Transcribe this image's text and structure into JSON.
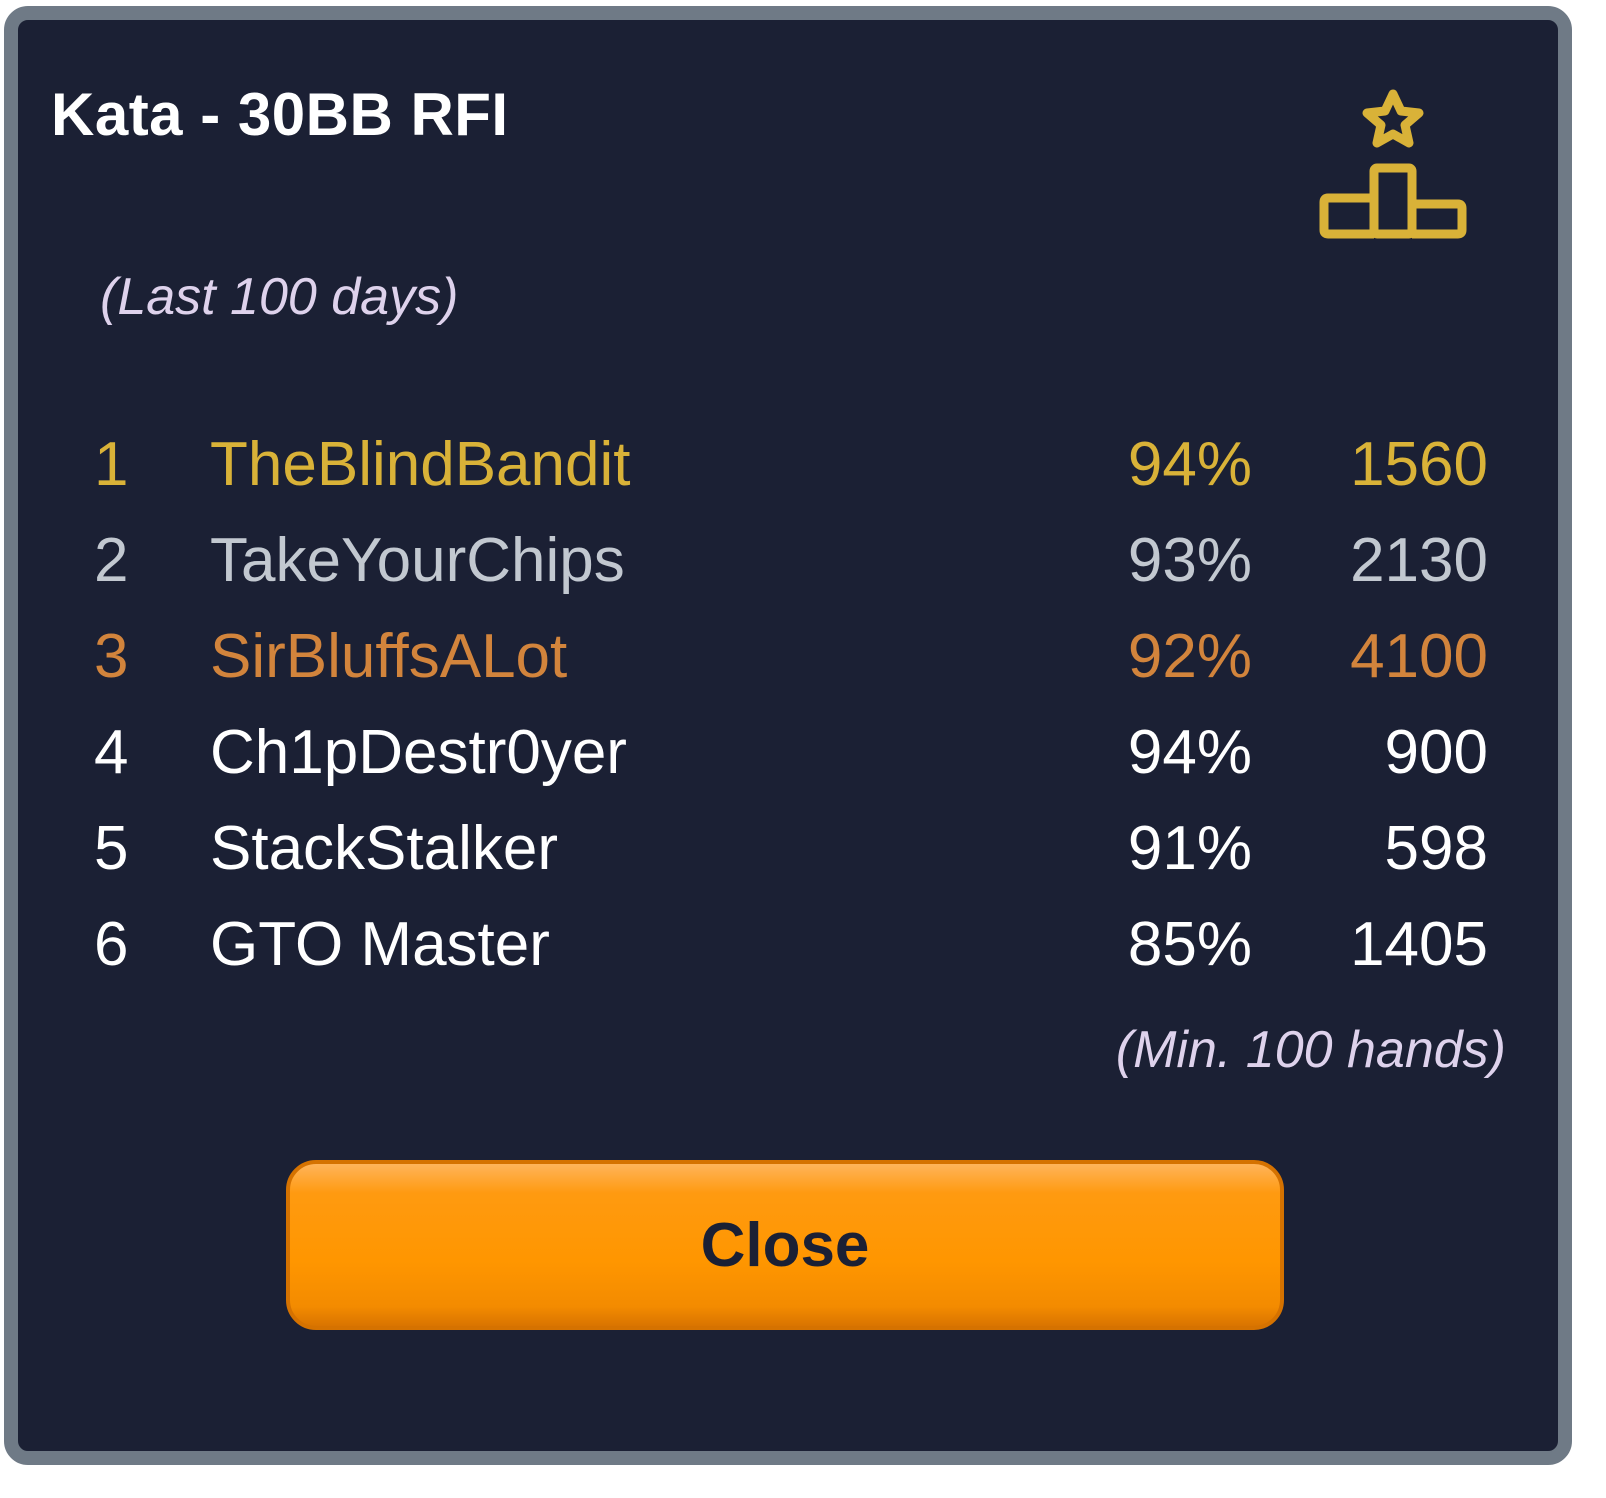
{
  "modal": {
    "title": "Kata - 30BB RFI",
    "subtitle": "(Last 100 days)",
    "icon": "podium-star-icon",
    "footnote": "(Min. 100 hands)",
    "close_label": "Close"
  },
  "colors": {
    "background": "#1b2034",
    "border": "#6f7a86",
    "gold": "#d9b238",
    "silver": "#c2c8d0",
    "bronze": "#d2843c",
    "text": "#ffffff",
    "muted": "#ded2ec",
    "button": "#ff9600"
  },
  "leaderboard": [
    {
      "rank": "1",
      "name": "TheBlindBandit",
      "percent": "94%",
      "hands": "1560",
      "medal": "gold"
    },
    {
      "rank": "2",
      "name": "TakeYourChips",
      "percent": "93%",
      "hands": "2130",
      "medal": "silver"
    },
    {
      "rank": "3",
      "name": "SirBluffsALot",
      "percent": "92%",
      "hands": "4100",
      "medal": "bronze"
    },
    {
      "rank": "4",
      "name": "Ch1pDestr0yer",
      "percent": "94%",
      "hands": "900",
      "medal": "none"
    },
    {
      "rank": "5",
      "name": "StackStalker",
      "percent": "91%",
      "hands": "598",
      "medal": "none"
    },
    {
      "rank": "6",
      "name": "GTO Master",
      "percent": "85%",
      "hands": "1405",
      "medal": "none"
    }
  ]
}
